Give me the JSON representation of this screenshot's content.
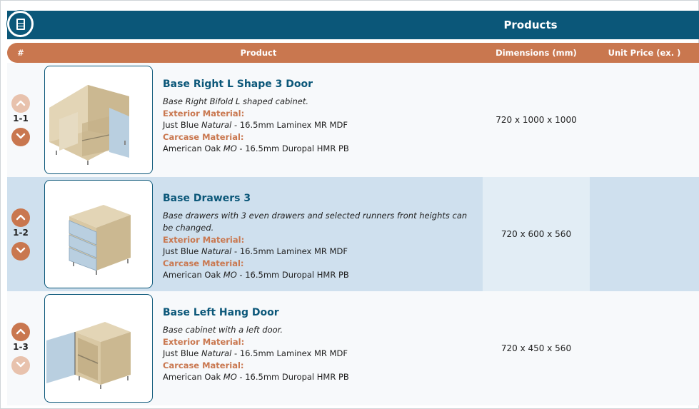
{
  "header": {
    "title": "Products"
  },
  "columns": {
    "num": "#",
    "product": "Product",
    "dimensions": "Dimensions (mm)",
    "unit_price": "Unit Price (ex. )"
  },
  "rows": [
    {
      "num": "1-1",
      "name": "Base Right L Shape 3 Door",
      "description": "Base Right Bifold L shaped cabinet.",
      "exterior_label": "Exterior Material:",
      "exterior_pre": "Just Blue ",
      "exterior_em": "Natural",
      "exterior_post": " - 16.5mm Laminex MR MDF",
      "carcase_label": "Carcase Material:",
      "carcase_pre": "American Oak ",
      "carcase_em": "MO",
      "carcase_post": " - 16.5mm Duropal HMR PB",
      "dimensions": "720 x 1000 x 1000",
      "unit_price": ""
    },
    {
      "num": "1-2",
      "name": "Base Drawers 3",
      "description": "Base drawers with 3 even drawers and selected runners front heights can be changed.",
      "exterior_label": "Exterior Material:",
      "exterior_pre": "Just Blue ",
      "exterior_em": "Natural",
      "exterior_post": " - 16.5mm Laminex MR MDF",
      "carcase_label": "Carcase Material:",
      "carcase_pre": "American Oak ",
      "carcase_em": "MO",
      "carcase_post": " - 16.5mm Duropal HMR PB",
      "dimensions": "720 x 600 x 560",
      "unit_price": ""
    },
    {
      "num": "1-3",
      "name": "Base Left Hang Door",
      "description": "Base cabinet with a left door.",
      "exterior_label": "Exterior Material:",
      "exterior_pre": "Just Blue ",
      "exterior_em": "Natural",
      "exterior_post": " - 16.5mm Laminex MR MDF",
      "carcase_label": "Carcase Material:",
      "carcase_pre": "American Oak ",
      "carcase_em": "MO",
      "carcase_post": " - 16.5mm Duropal HMR PB",
      "dimensions": "720 x 450 x 560",
      "unit_price": ""
    }
  ],
  "colors": {
    "header": "#0b5779",
    "accent": "#c9774f",
    "row_alt": "#cfe0ee",
    "oak": "#d8c7a3",
    "blue_panel": "#b9cfe0"
  },
  "icons": {
    "logo": "cabinet-icon",
    "up": "chevron-up-icon",
    "down": "chevron-down-icon"
  }
}
